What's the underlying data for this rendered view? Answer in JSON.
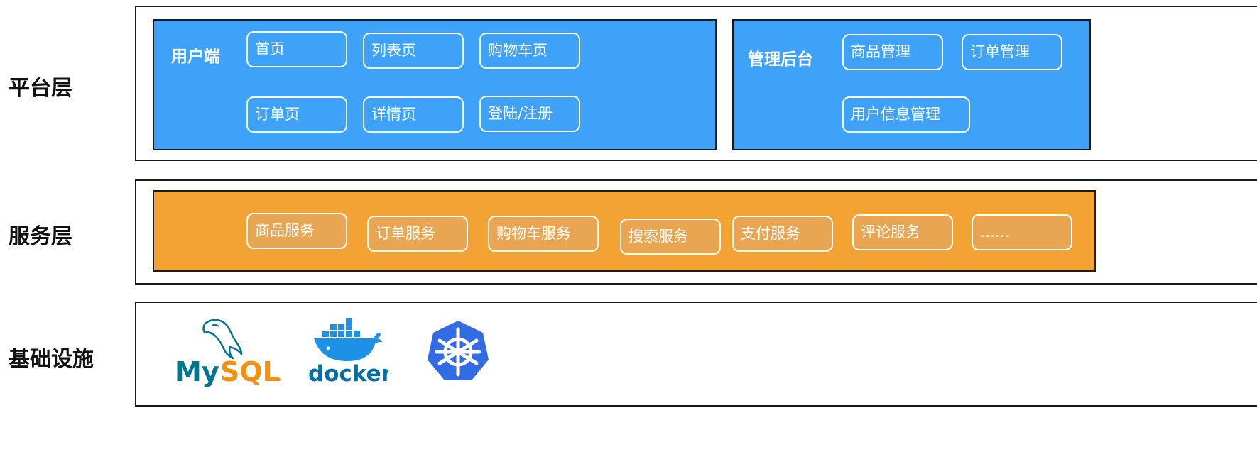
{
  "layers": {
    "platform": "平台层",
    "service": "服务层",
    "infra": "基础设施"
  },
  "platform": {
    "user_side": {
      "title": "用户端",
      "pages": [
        "首页",
        "列表页",
        "购物车页",
        "订单页",
        "详情页",
        "登陆/注册"
      ]
    },
    "admin": {
      "title": "管理后台",
      "items": [
        "商品管理",
        "订单管理",
        "用户信息管理"
      ]
    }
  },
  "services": [
    "商品服务",
    "订单服务",
    "购物车服务",
    "搜索服务",
    "支付服务",
    "评论服务",
    "……"
  ],
  "infra": {
    "mysql": {
      "text_my": "My",
      "text_sql": "SQL",
      "dot": "."
    },
    "docker": {
      "text": "docker"
    }
  },
  "colors": {
    "platform_bg": "#3fa2f9",
    "service_bg": "#f2a333",
    "service_chip": "#e8a653",
    "mysql_blue": "#00758f",
    "mysql_orange": "#f29111",
    "docker_blue": "#1d91e6",
    "k8s_blue": "#326ce5"
  }
}
